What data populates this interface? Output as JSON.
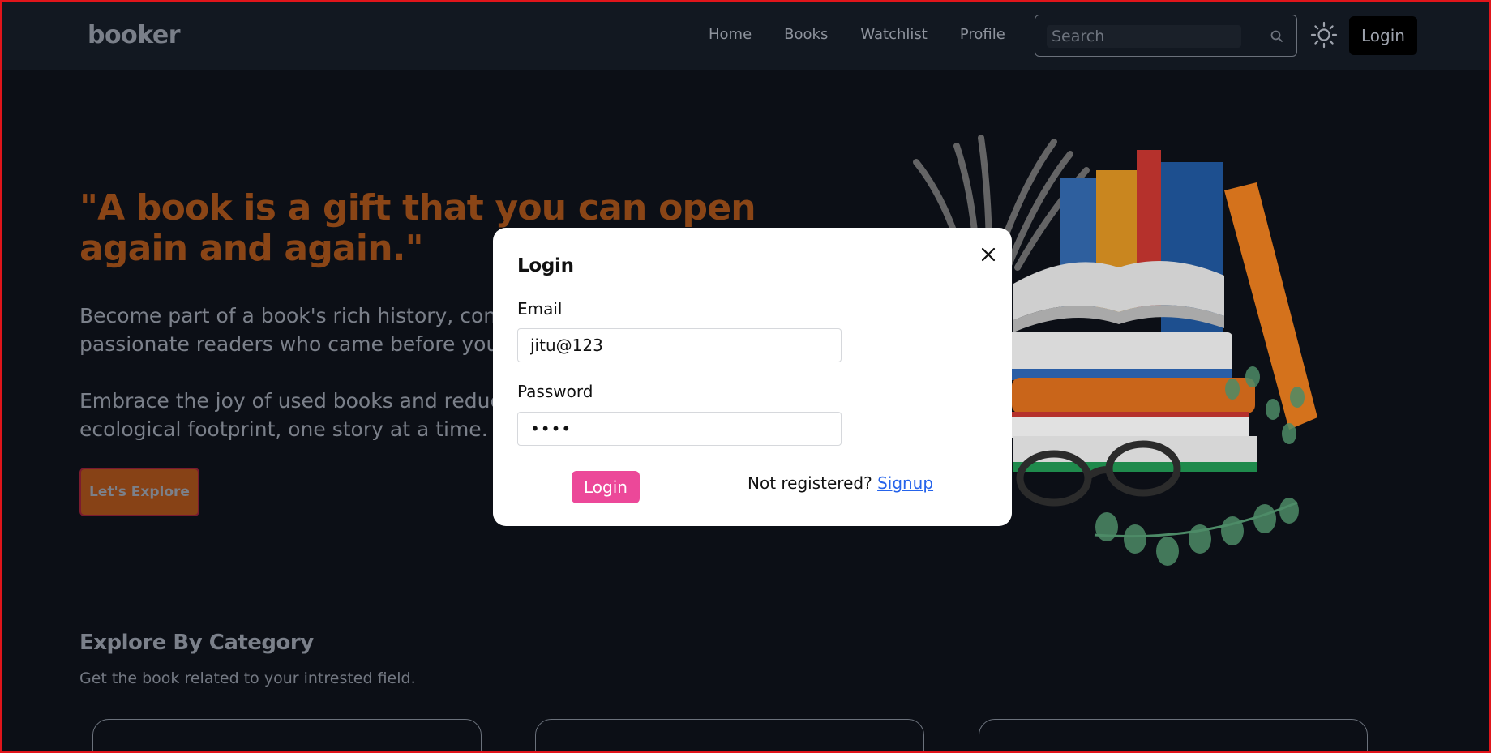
{
  "navbar": {
    "brand": "booker",
    "links": [
      "Home",
      "Books",
      "Watchlist",
      "Profile"
    ],
    "search_placeholder": "Search",
    "login_label": "Login"
  },
  "hero": {
    "quote": "\"A book is a gift that you can open again and again.\"",
    "paragraph1": "Become part of a book's rich history, connecting with the passionate readers who came before you.",
    "paragraph2": "Embrace the joy of used books and reduce your ecological footprint, one story at a time.",
    "explore_label": "Let's Explore"
  },
  "explore": {
    "title": "Explore By Category",
    "subtitle": "Get the book related to your intrested field."
  },
  "modal": {
    "title": "Login",
    "email_label": "Email",
    "email_value": "jitu@123",
    "password_label": "Password",
    "password_value": "••••",
    "login_label": "Login",
    "not_registered": "Not registered? ",
    "signup_label": "Signup"
  },
  "colors": {
    "accent_orange": "#8a4516",
    "modal_button": "#ec4899",
    "link": "#2563eb",
    "frame": "#e0151b"
  },
  "icons": {
    "search": "search-icon",
    "theme": "sun-icon",
    "close": "close-icon"
  }
}
